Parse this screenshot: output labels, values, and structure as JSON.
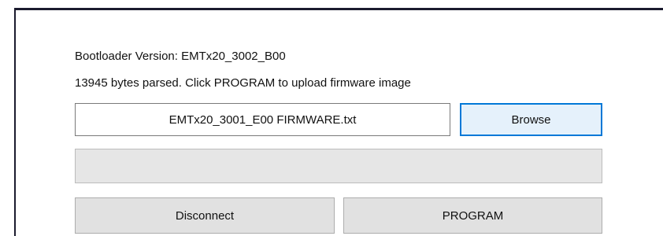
{
  "bootloader": {
    "version_text": "Bootloader Version: EMTx20_3002_B00"
  },
  "status": {
    "message": "13945 bytes parsed. Click PROGRAM to upload firmware image"
  },
  "file": {
    "selected_file": "EMTx20_3001_E00 FIRMWARE.txt"
  },
  "buttons": {
    "browse_label": "Browse",
    "disconnect_label": "Disconnect",
    "program_label": "PROGRAM"
  },
  "progress": {
    "value_percent": 0
  },
  "colors": {
    "accent_focus": "#0078d7",
    "button_bg": "#e1e1e1",
    "progress_track": "#e6e6e6"
  }
}
